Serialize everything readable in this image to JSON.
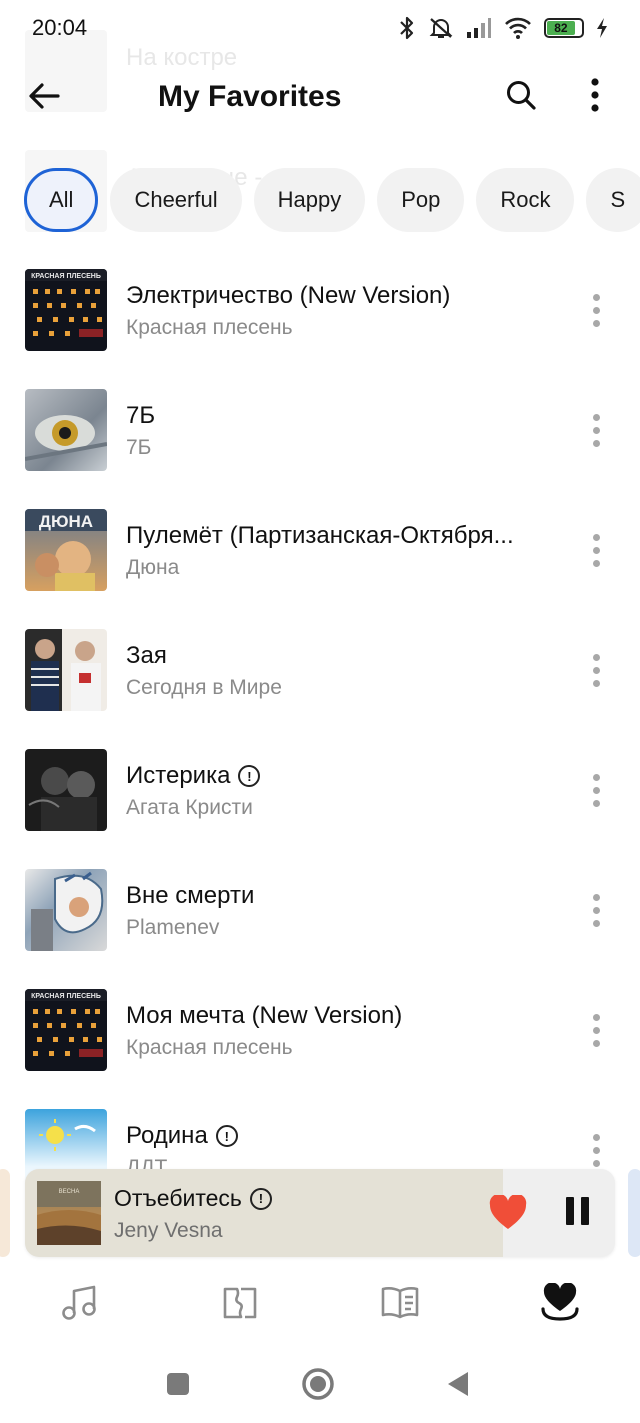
{
  "status_bar": {
    "time": "20:04",
    "battery_percent": "82",
    "icons": [
      "bluetooth-icon",
      "mute-icon",
      "signal-icon",
      "wifi-icon",
      "battery-icon",
      "charging-icon"
    ]
  },
  "background_rows": [
    {
      "title": "На костре"
    },
    {
      "title": "А на улице - мороз..."
    }
  ],
  "header": {
    "title": "My Favorites",
    "back_icon": "arrow-left-icon",
    "search_icon": "search-icon",
    "more_icon": "more-vertical-icon"
  },
  "chips": [
    {
      "label": "All",
      "selected": true
    },
    {
      "label": "Cheerful",
      "selected": false
    },
    {
      "label": "Happy",
      "selected": false
    },
    {
      "label": "Pop",
      "selected": false
    },
    {
      "label": "Rock",
      "selected": false
    },
    {
      "label": "S",
      "selected": false
    }
  ],
  "tracks": [
    {
      "title": "Электричество (New Version)",
      "artist": "Красная плесень",
      "explicit": false
    },
    {
      "title": "7Б",
      "artist": "7Б",
      "explicit": false
    },
    {
      "title": "Пулемёт (Партизанская-Октября...",
      "artist": "Дюна",
      "explicit": false
    },
    {
      "title": "Зая",
      "artist": "Сегодня в Мире",
      "explicit": false
    },
    {
      "title": "Истерика",
      "artist": "Агата Кристи",
      "explicit": true
    },
    {
      "title": "Вне смерти",
      "artist": "Plamenev",
      "explicit": false
    },
    {
      "title": "Моя мечта (New Version)",
      "artist": "Красная плесень",
      "explicit": false
    },
    {
      "title": "Родина",
      "artist": "ДДТ",
      "explicit": true
    }
  ],
  "mini_player": {
    "title": "Отъебитесь",
    "artist": "Jeny Vesna",
    "explicit": true,
    "progress": 0.81,
    "liked": true,
    "like_color": "#f04e38",
    "state": "playing"
  },
  "bottom_nav": [
    {
      "name": "music-note-icon",
      "active": false
    },
    {
      "name": "map-icon",
      "active": false
    },
    {
      "name": "book-icon",
      "active": false
    },
    {
      "name": "heart-collection-icon",
      "active": true
    }
  ],
  "colors": {
    "accent": "#1e63d6",
    "secondary_text": "#8a8a8a",
    "chip_background": "#f2f2f2"
  }
}
